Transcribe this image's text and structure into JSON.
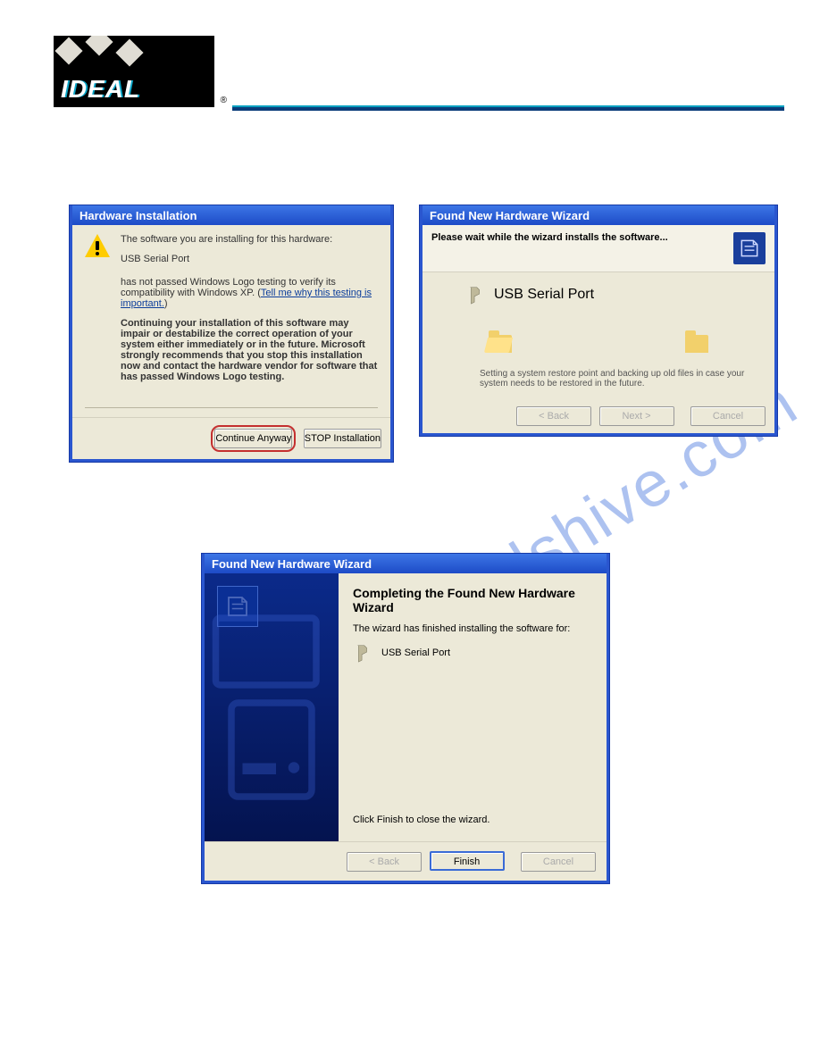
{
  "logo": {
    "text": "IDEAL",
    "registered": "®"
  },
  "watermark": "manualshive.com",
  "dlg1": {
    "title": "Hardware Installation",
    "intro": "The software you are installing for this hardware:",
    "device": "USB Serial Port",
    "para": "has not passed Windows Logo testing to verify its compatibility with Windows XP. (",
    "link": "Tell me why this testing is important.",
    "para_end": ")",
    "bold": "Continuing your installation of this software may impair or destabilize the correct operation of your system either immediately or in the future. Microsoft strongly recommends that you stop this installation now and contact the hardware vendor for software that has passed Windows Logo testing.",
    "btn_continue": "Continue Anyway",
    "btn_stop": "STOP Installation"
  },
  "dlg2": {
    "title": "Found New Hardware Wizard",
    "heading": "Please wait while the wizard installs the software...",
    "device": "USB Serial Port",
    "msg": "Setting a system restore point and backing up old files in case your system needs to be restored in the future.",
    "btn_back": "< Back",
    "btn_next": "Next >",
    "btn_cancel": "Cancel"
  },
  "dlg3": {
    "title": "Found New Hardware Wizard",
    "heading": "Completing the Found New Hardware Wizard",
    "para": "The wizard has finished installing the software for:",
    "device": "USB Serial Port",
    "close_msg": "Click Finish to close the wizard.",
    "btn_back": "< Back",
    "btn_finish": "Finish",
    "btn_cancel": "Cancel"
  }
}
